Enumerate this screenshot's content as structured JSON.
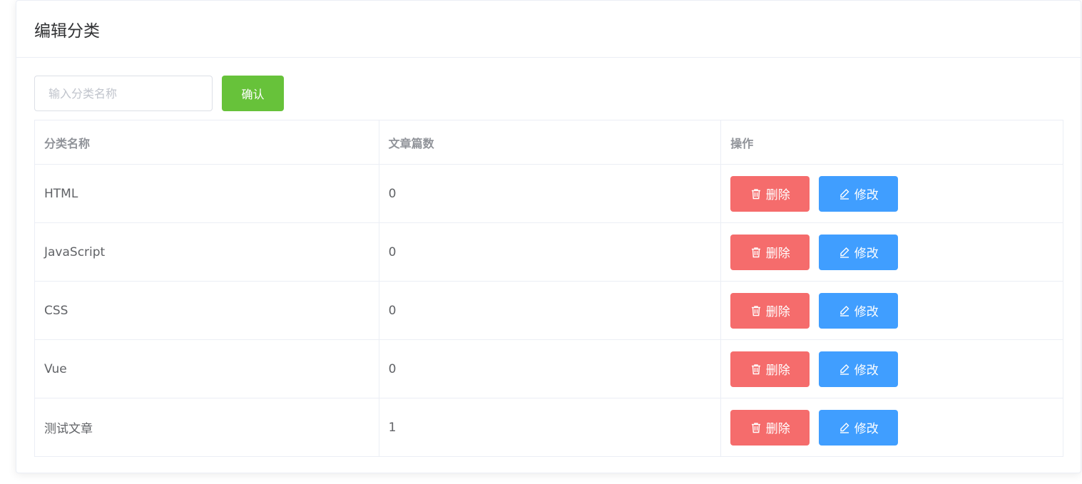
{
  "card": {
    "title": "编辑分类"
  },
  "toolbar": {
    "input_placeholder": "输入分类名称",
    "input_value": "",
    "confirm_label": "确认"
  },
  "table": {
    "headers": [
      "分类名称",
      "文章篇数",
      "操作"
    ],
    "rows": [
      {
        "name": "HTML",
        "count": "0"
      },
      {
        "name": "JavaScript",
        "count": "0"
      },
      {
        "name": "CSS",
        "count": "0"
      },
      {
        "name": "Vue",
        "count": "0"
      },
      {
        "name": "测试文章",
        "count": "1"
      }
    ],
    "delete_label": "删除",
    "edit_label": "修改"
  },
  "icons": {
    "delete": "trash-icon",
    "edit": "edit-pen-icon"
  },
  "colors": {
    "confirm": "#67c23a",
    "delete": "#f56c6c",
    "edit": "#409eff"
  }
}
